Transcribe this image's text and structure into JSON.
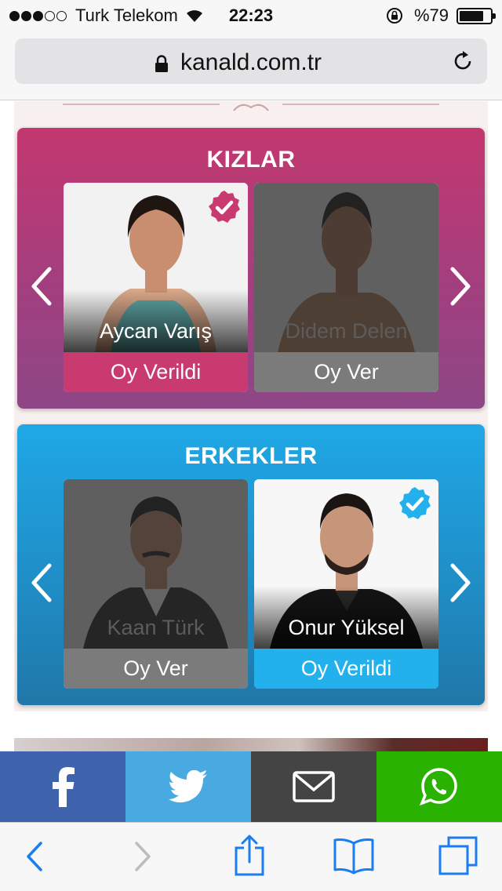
{
  "status_bar": {
    "carrier": "Turk Telekom",
    "time": "22:23",
    "battery": "%79",
    "signal_bars_filled": 3,
    "signal_bars_total": 5,
    "battery_level": 0.79
  },
  "browser": {
    "url": "kanald.com.tr"
  },
  "voting": {
    "girls": {
      "title": "KIZLAR",
      "candidates": [
        {
          "name": "Aycan Varış",
          "vote_label": "Oy Verildi",
          "voted": true
        },
        {
          "name": "Didem Delen",
          "vote_label": "Oy Ver",
          "voted": false
        }
      ]
    },
    "boys": {
      "title": "ERKEKLER",
      "candidates": [
        {
          "name": "Kaan Türk",
          "vote_label": "Oy Ver",
          "voted": false
        },
        {
          "name": "Onur Yüksel",
          "vote_label": "Oy Verildi",
          "voted": true
        }
      ]
    }
  },
  "colors": {
    "girls_accent": "#c93a70",
    "boys_accent": "#22b1ec",
    "not_voted": "#7b7b7b",
    "facebook": "#3f64ad",
    "twitter": "#48aae0",
    "mail": "#444444",
    "whatsapp": "#2ab200"
  },
  "share_bar": [
    "facebook-icon",
    "twitter-icon",
    "mail-icon",
    "whatsapp-icon"
  ],
  "toolbar": [
    "back-icon",
    "forward-icon",
    "share-icon",
    "bookmarks-icon",
    "tabs-icon"
  ]
}
